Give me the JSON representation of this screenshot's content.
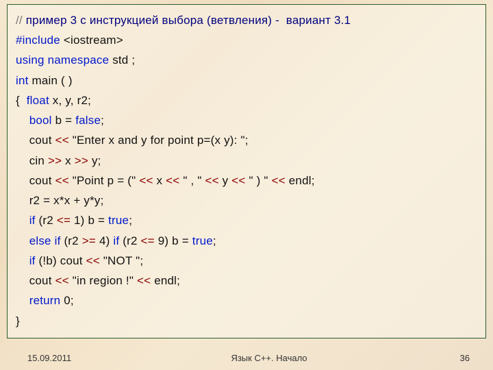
{
  "code": {
    "l1_a": "// ",
    "l1_b": "пример 3 с инструкцией выбора (ветвления) -  вариант 3.1",
    "l2_a": "#include ",
    "l2_b": "<iostream>",
    "l3_a": "using namespace ",
    "l3_b": "std ;",
    "l4_a": "int ",
    "l4_b": "main ( )",
    "l5_a": "{  ",
    "l5_b": "float ",
    "l5_c": "x, y, r2;",
    "l6_a": "    ",
    "l6_b": "bool ",
    "l6_c": "b = ",
    "l6_d": "false",
    "l6_e": ";",
    "l7_a": "    cout ",
    "l7_b": "<<",
    "l7_c": " \"Enter x and y for point p=(x y): \";",
    "l8_a": "    cin ",
    "l8_b": ">>",
    "l8_c": " x ",
    "l8_d": ">>",
    "l8_e": " y;",
    "l9_a": "    cout ",
    "l9_b": "<<",
    "l9_c": " \"Point p = (\" ",
    "l9_d": "<<",
    "l9_e": " x ",
    "l9_f": "<<",
    "l9_g": " \" , \" ",
    "l9_h": "<<",
    "l9_i": " y ",
    "l9_j": "<<",
    "l9_k": " \" ) \" ",
    "l9_l": "<<",
    "l9_m": " endl;",
    "l10": "    r2 = x*x + y*y;",
    "l11_a": "    ",
    "l11_b": "if ",
    "l11_c": "(r2 ",
    "l11_d": "<=",
    "l11_e": " 1) b = ",
    "l11_f": "true",
    "l11_g": ";",
    "l12_a": "    ",
    "l12_b": "else if ",
    "l12_c": "(r2 ",
    "l12_d": ">=",
    "l12_e": " 4) ",
    "l12_f": "if ",
    "l12_g": "(r2 ",
    "l12_h": "<=",
    "l12_i": " 9) b = ",
    "l12_j": "true",
    "l12_k": ";",
    "l13_a": "    ",
    "l13_b": "if ",
    "l13_c": "(!b) cout ",
    "l13_d": "<<",
    "l13_e": " \"NOT \";",
    "l14_a": "    cout ",
    "l14_b": "<<",
    "l14_c": " \"in region !\" ",
    "l14_d": "<<",
    "l14_e": " endl;",
    "l15_a": "    ",
    "l15_b": "return ",
    "l15_c": "0;",
    "l16": "}"
  },
  "footer": {
    "date": "15.09.2011",
    "title": "Язык С++. Начало",
    "page": "36"
  }
}
